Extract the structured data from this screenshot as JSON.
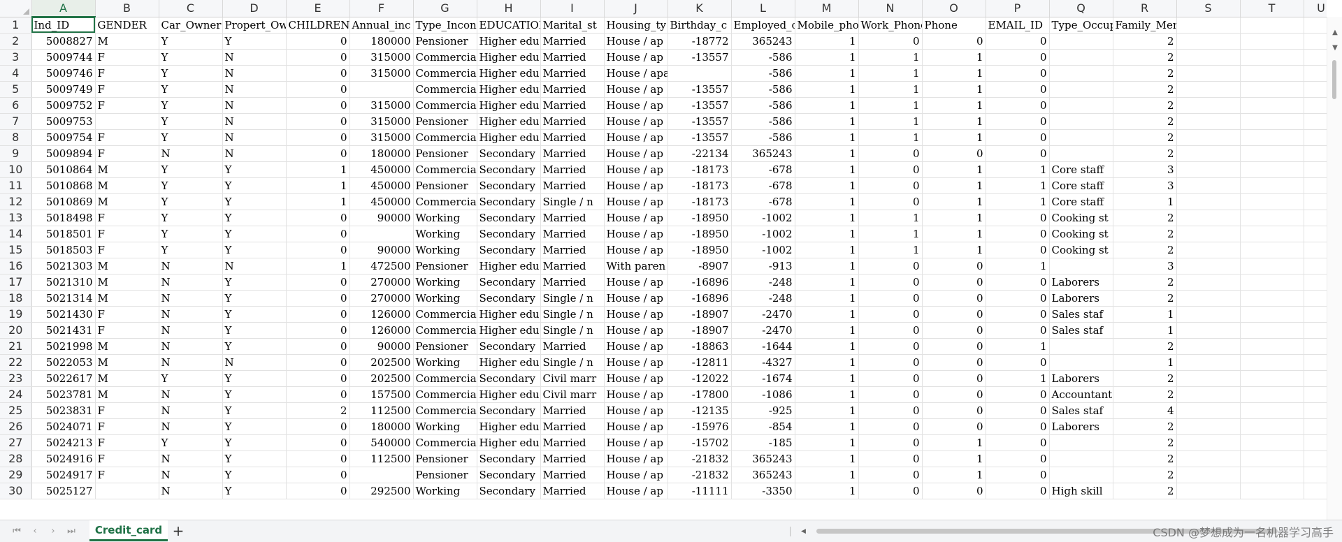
{
  "sheet": {
    "tab_label": "Credit_card",
    "add_label": "+",
    "columns": [
      "A",
      "B",
      "C",
      "D",
      "E",
      "F",
      "G",
      "H",
      "I",
      "J",
      "K",
      "L",
      "M",
      "N",
      "O",
      "P",
      "Q",
      "R",
      "S",
      "T",
      "U"
    ],
    "selected_cell": "A1",
    "header_row": [
      "Ind_ID",
      "GENDER",
      "Car_Owner",
      "Propert_Ow",
      "CHILDREN",
      "Annual_inc",
      "Type_Incon",
      "EDUCATION",
      "Marital_st",
      "Housing_ty",
      "Birthday_c",
      "Employed_c",
      "Mobile_pho",
      "Work_Phone",
      "Phone",
      "EMAIL_ID",
      "Type_Occup",
      "Family_Members"
    ],
    "rows": [
      [
        "5008827",
        "M",
        "Y",
        "Y",
        "0",
        "180000",
        "Pensioner",
        "Higher edu",
        "Married",
        "House / ap",
        "-18772",
        "365243",
        "1",
        "0",
        "0",
        "0",
        "",
        "2"
      ],
      [
        "5009744",
        "F",
        "Y",
        "N",
        "0",
        "315000",
        "Commercial",
        "Higher edu",
        "Married",
        "House / ap",
        "-13557",
        "-586",
        "1",
        "1",
        "1",
        "0",
        "",
        "2"
      ],
      [
        "5009746",
        "F",
        "Y",
        "N",
        "0",
        "315000",
        "Commercial",
        "Higher edu",
        "Married",
        "House / apartment",
        "",
        "-586",
        "1",
        "1",
        "1",
        "0",
        "",
        "2"
      ],
      [
        "5009749",
        "F",
        "Y",
        "N",
        "0",
        "",
        "Commercial",
        "Higher edu",
        "Married",
        "House / ap",
        "-13557",
        "-586",
        "1",
        "1",
        "1",
        "0",
        "",
        "2"
      ],
      [
        "5009752",
        "F",
        "Y",
        "N",
        "0",
        "315000",
        "Commercial",
        "Higher edu",
        "Married",
        "House / ap",
        "-13557",
        "-586",
        "1",
        "1",
        "1",
        "0",
        "",
        "2"
      ],
      [
        "5009753",
        "",
        "Y",
        "N",
        "0",
        "315000",
        "Pensioner",
        "Higher edu",
        "Married",
        "House / ap",
        "-13557",
        "-586",
        "1",
        "1",
        "1",
        "0",
        "",
        "2"
      ],
      [
        "5009754",
        "F",
        "Y",
        "N",
        "0",
        "315000",
        "Commercial",
        "Higher edu",
        "Married",
        "House / ap",
        "-13557",
        "-586",
        "1",
        "1",
        "1",
        "0",
        "",
        "2"
      ],
      [
        "5009894",
        "F",
        "N",
        "N",
        "0",
        "180000",
        "Pensioner",
        "Secondary",
        "Married",
        "House / ap",
        "-22134",
        "365243",
        "1",
        "0",
        "0",
        "0",
        "",
        "2"
      ],
      [
        "5010864",
        "M",
        "Y",
        "Y",
        "1",
        "450000",
        "Commercial",
        "Secondary",
        "Married",
        "House / ap",
        "-18173",
        "-678",
        "1",
        "0",
        "1",
        "1",
        "Core staff",
        "3"
      ],
      [
        "5010868",
        "M",
        "Y",
        "Y",
        "1",
        "450000",
        "Pensioner",
        "Secondary",
        "Married",
        "House / ap",
        "-18173",
        "-678",
        "1",
        "0",
        "1",
        "1",
        "Core staff",
        "3"
      ],
      [
        "5010869",
        "M",
        "Y",
        "Y",
        "1",
        "450000",
        "Commercial",
        "Secondary",
        "Single / n",
        "House / ap",
        "-18173",
        "-678",
        "1",
        "0",
        "1",
        "1",
        "Core staff",
        "1"
      ],
      [
        "5018498",
        "F",
        "Y",
        "Y",
        "0",
        "90000",
        "Working",
        "Secondary",
        "Married",
        "House / ap",
        "-18950",
        "-1002",
        "1",
        "1",
        "1",
        "0",
        "Cooking st",
        "2"
      ],
      [
        "5018501",
        "F",
        "Y",
        "Y",
        "0",
        "",
        "Working",
        "Secondary",
        "Married",
        "House / ap",
        "-18950",
        "-1002",
        "1",
        "1",
        "1",
        "0",
        "Cooking st",
        "2"
      ],
      [
        "5018503",
        "F",
        "Y",
        "Y",
        "0",
        "90000",
        "Working",
        "Secondary",
        "Married",
        "House / ap",
        "-18950",
        "-1002",
        "1",
        "1",
        "1",
        "0",
        "Cooking st",
        "2"
      ],
      [
        "5021303",
        "M",
        "N",
        "N",
        "1",
        "472500",
        "Pensioner",
        "Higher edu",
        "Married",
        "With paren",
        "-8907",
        "-913",
        "1",
        "0",
        "0",
        "1",
        "",
        "3"
      ],
      [
        "5021310",
        "M",
        "N",
        "Y",
        "0",
        "270000",
        "Working",
        "Secondary",
        "Married",
        "House / ap",
        "-16896",
        "-248",
        "1",
        "0",
        "0",
        "0",
        "Laborers",
        "2"
      ],
      [
        "5021314",
        "M",
        "N",
        "Y",
        "0",
        "270000",
        "Working",
        "Secondary",
        "Single / n",
        "House / ap",
        "-16896",
        "-248",
        "1",
        "0",
        "0",
        "0",
        "Laborers",
        "2"
      ],
      [
        "5021430",
        "F",
        "N",
        "Y",
        "0",
        "126000",
        "Commercial",
        "Higher edu",
        "Single / n",
        "House / ap",
        "-18907",
        "-2470",
        "1",
        "0",
        "0",
        "0",
        "Sales staf",
        "1"
      ],
      [
        "5021431",
        "F",
        "N",
        "Y",
        "0",
        "126000",
        "Commercial",
        "Higher edu",
        "Single / n",
        "House / ap",
        "-18907",
        "-2470",
        "1",
        "0",
        "0",
        "0",
        "Sales staf",
        "1"
      ],
      [
        "5021998",
        "M",
        "N",
        "Y",
        "0",
        "90000",
        "Pensioner",
        "Secondary",
        "Married",
        "House / ap",
        "-18863",
        "-1644",
        "1",
        "0",
        "0",
        "1",
        "",
        "2"
      ],
      [
        "5022053",
        "M",
        "N",
        "N",
        "0",
        "202500",
        "Working",
        "Higher edu",
        "Single / n",
        "House / ap",
        "-12811",
        "-4327",
        "1",
        "0",
        "0",
        "0",
        "",
        "1"
      ],
      [
        "5022617",
        "M",
        "Y",
        "Y",
        "0",
        "202500",
        "Commercial",
        "Secondary",
        "Civil marr",
        "House / ap",
        "-12022",
        "-1674",
        "1",
        "0",
        "0",
        "1",
        "Laborers",
        "2"
      ],
      [
        "5023781",
        "M",
        "N",
        "Y",
        "0",
        "157500",
        "Commercial",
        "Higher edu",
        "Civil marr",
        "House / ap",
        "-17800",
        "-1086",
        "1",
        "0",
        "0",
        "0",
        "Accountant",
        "2"
      ],
      [
        "5023831",
        "F",
        "N",
        "Y",
        "2",
        "112500",
        "Commercial",
        "Secondary",
        "Married",
        "House / ap",
        "-12135",
        "-925",
        "1",
        "0",
        "0",
        "0",
        "Sales staf",
        "4"
      ],
      [
        "5024071",
        "F",
        "N",
        "Y",
        "0",
        "180000",
        "Working",
        "Higher edu",
        "Married",
        "House / ap",
        "-15976",
        "-854",
        "1",
        "0",
        "0",
        "0",
        "Laborers",
        "2"
      ],
      [
        "5024213",
        "F",
        "Y",
        "Y",
        "0",
        "540000",
        "Commercial",
        "Higher edu",
        "Married",
        "House / ap",
        "-15702",
        "-185",
        "1",
        "0",
        "1",
        "0",
        "",
        "2"
      ],
      [
        "5024916",
        "F",
        "N",
        "Y",
        "0",
        "112500",
        "Pensioner",
        "Secondary",
        "Married",
        "House / ap",
        "-21832",
        "365243",
        "1",
        "0",
        "1",
        "0",
        "",
        "2"
      ],
      [
        "5024917",
        "F",
        "N",
        "Y",
        "0",
        "",
        "Pensioner",
        "Secondary",
        "Married",
        "House / ap",
        "-21832",
        "365243",
        "1",
        "0",
        "1",
        "0",
        "",
        "2"
      ],
      [
        "5025127",
        "",
        "N",
        "Y",
        "0",
        "292500",
        "Working",
        "Secondary",
        "Married",
        "House / ap",
        "-11111",
        "-3350",
        "1",
        "0",
        "0",
        "0",
        "High skill",
        "2"
      ]
    ]
  },
  "watermark": "CSDN @梦想成为一名机器学习高手"
}
